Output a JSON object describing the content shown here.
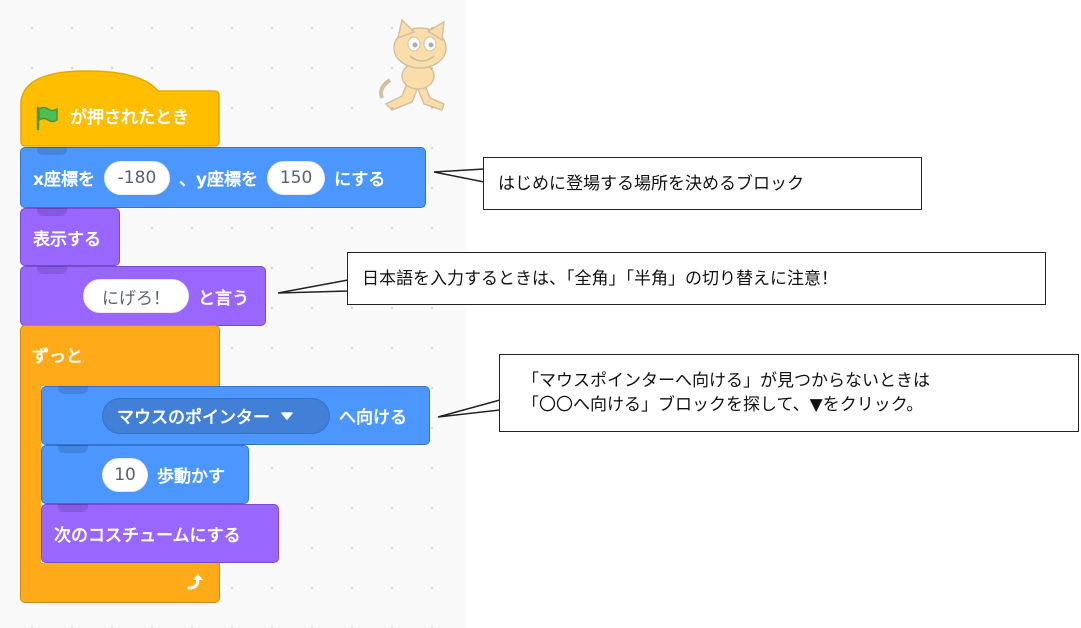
{
  "blocks": {
    "hat_label": "が押されたとき",
    "goto_x_label": "x座標を",
    "goto_x_value": "-180",
    "goto_y_label": "、y座標を",
    "goto_y_value": "150",
    "goto_suffix": "にする",
    "show_label": "表示する",
    "say_value": "にげろ！",
    "say_suffix": "と言う",
    "forever_label": "ずっと",
    "point_towards_option": "マウスのポインター",
    "point_towards_suffix": "へ向ける",
    "move_value": "10",
    "move_suffix": "歩動かす",
    "next_costume_label": "次のコスチュームにする"
  },
  "callouts": {
    "goto_note": "はじめに登場する場所を決めるブロック",
    "say_note": "日本語を入力するときは、「全角」「半角」の切り替えに注意！",
    "point_note_line1": "「マウスポインターへ向ける」が見つからないときは",
    "point_note_line2": "「〇〇へ向ける」ブロックを探して、▼をクリック。"
  },
  "colors": {
    "events": "#ffbf00",
    "motion": "#4c97ff",
    "looks": "#9966ff",
    "control": "#ffab19",
    "flag": "#4cbf56",
    "canvas": "#f9f9f9"
  },
  "icons": [
    "green-flag-icon",
    "dropdown-arrow-icon",
    "loop-arrow-icon",
    "scratch-cat-sprite"
  ]
}
